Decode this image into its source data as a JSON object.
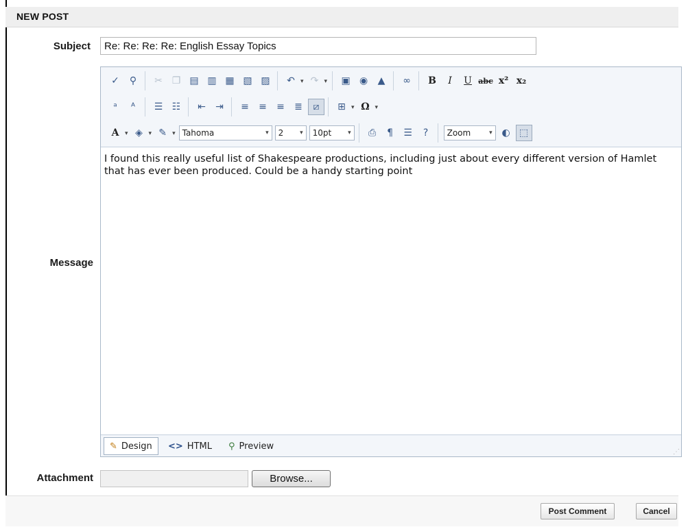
{
  "form": {
    "title": "NEW POST",
    "subject_label": "Subject",
    "subject_value": "Re: Re: Re: Re: English Essay Topics",
    "message_label": "Message",
    "attachment_label": "Attachment",
    "browse_label": "Browse...",
    "post_label": "Post Comment",
    "cancel_label": "Cancel"
  },
  "editor": {
    "font_name": "Tahoma",
    "font_size": "2",
    "point_size": "10pt",
    "zoom": "Zoom",
    "content": "I found this really useful list of Shakespeare productions, including just about every different version of Hamlet that has ever been produced. Could be a handy starting point",
    "modes": {
      "design": "Design",
      "html": "HTML",
      "preview": "Preview"
    }
  },
  "icons": {
    "spellcheck": "spellcheck-icon",
    "find": "find-icon",
    "cut": "cut-icon",
    "copy": "copy-icon",
    "paste": "paste-icon",
    "undo": "undo-icon",
    "redo": "redo-icon",
    "image": "image-icon",
    "media": "media-icon",
    "link": "link-icon",
    "bold": "bold-icon",
    "italic": "italic-icon",
    "underline": "underline-icon",
    "strike": "strikethrough-icon",
    "superscript": "superscript-icon",
    "subscript": "subscript-icon",
    "print": "print-icon",
    "help": "help-icon"
  },
  "glyphs": {
    "bold": "B",
    "italic": "I",
    "underline": "U",
    "strike": "abc",
    "superscript": "x²",
    "subscript": "x₂",
    "omega": "Ω",
    "font_color": "A"
  },
  "colors": {
    "toolbar_bg": "#f3f6fa",
    "border": "#a9b8c8",
    "accent": "#3a5a8a"
  }
}
